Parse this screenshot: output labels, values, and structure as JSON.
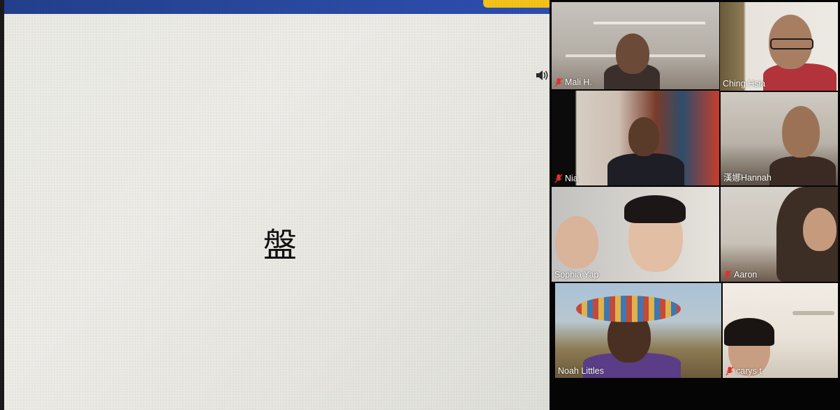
{
  "slide": {
    "character": "盤"
  },
  "gallery": {
    "participants": [
      {
        "name": "Mali H.",
        "muted": true,
        "active": false
      },
      {
        "name": "Ching Hsia",
        "muted": false,
        "active": true
      },
      {
        "name": "Nia",
        "muted": true,
        "active": false
      },
      {
        "name": "漢娜Hannah",
        "muted": false,
        "active": false
      },
      {
        "name": "Sophia Yap",
        "muted": false,
        "active": false
      },
      {
        "name": "Aaron",
        "muted": true,
        "active": false
      },
      {
        "name": "Noah Littles",
        "muted": false,
        "active": false
      },
      {
        "name": "carys t",
        "muted": true,
        "active": false
      }
    ]
  },
  "colors": {
    "top_bar": "#233f8b",
    "top_bar_accent": "#f3c21a",
    "active_outline": "#d8e24a",
    "muted_mic": "#e0302f"
  }
}
